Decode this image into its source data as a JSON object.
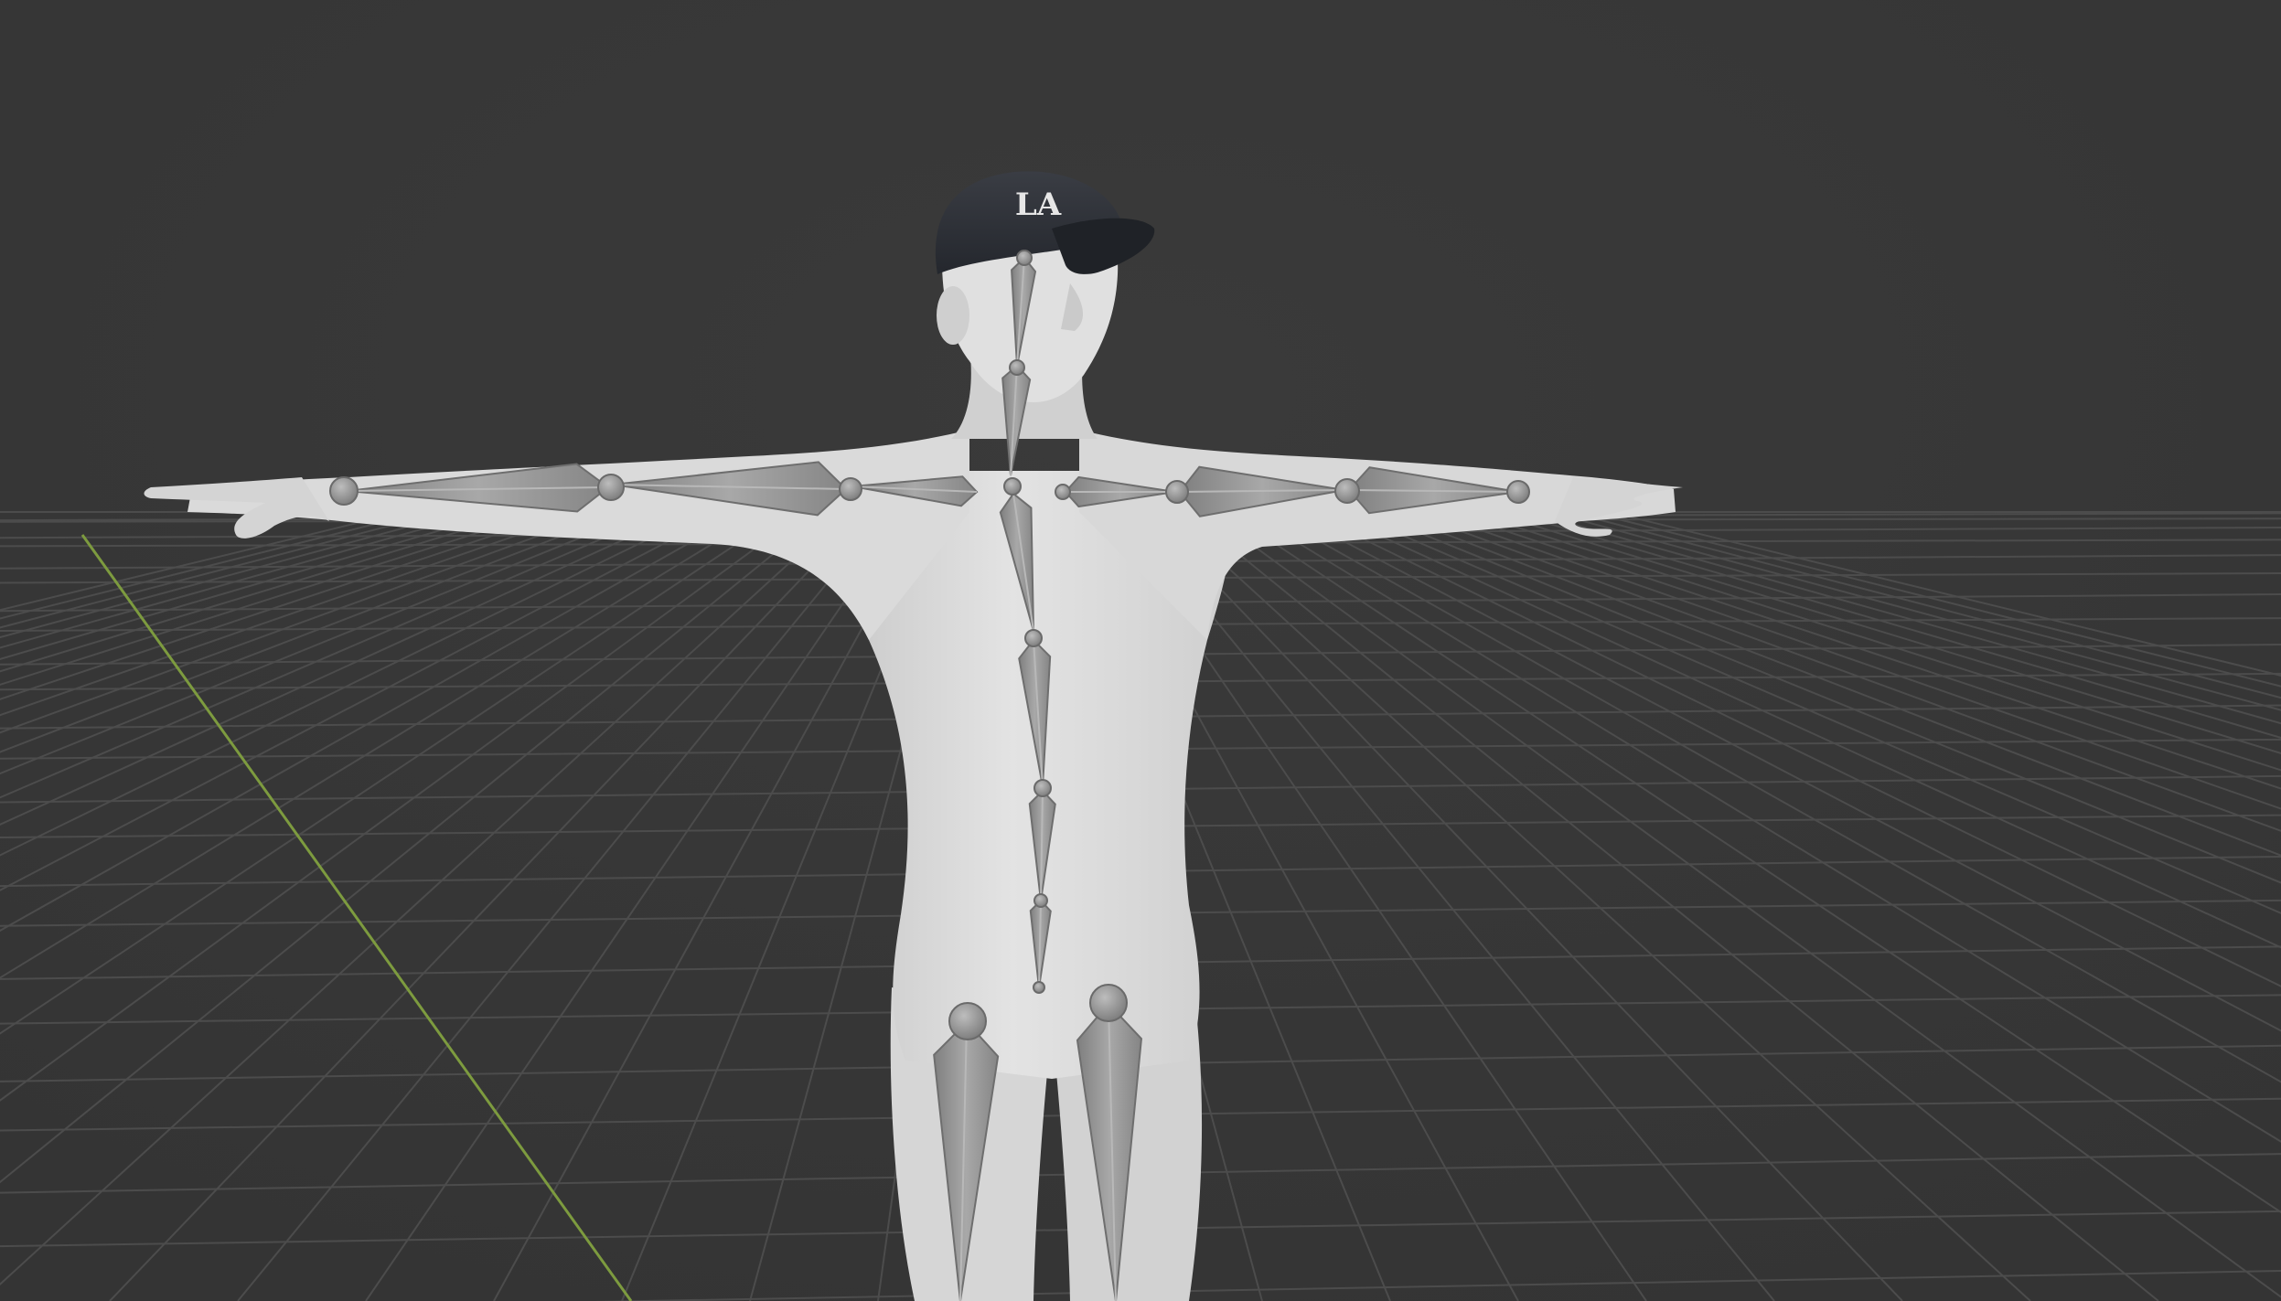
{
  "viewport": {
    "background": "#393939",
    "grid_color": "#4d4d4d",
    "y_axis_color": "#7d9b3f"
  },
  "scene": {
    "character": {
      "mesh_color": "#dcdcdc",
      "skin_shadow": "#bfbfbf",
      "cap_color": "#2d3036",
      "cap_brim_color": "#24272d",
      "cap_logo_text": "LA"
    },
    "armature": {
      "bone_color": "#8f8f8f",
      "bone_light": "#a6a6a6",
      "joint_color": "#8a8a8a"
    }
  }
}
